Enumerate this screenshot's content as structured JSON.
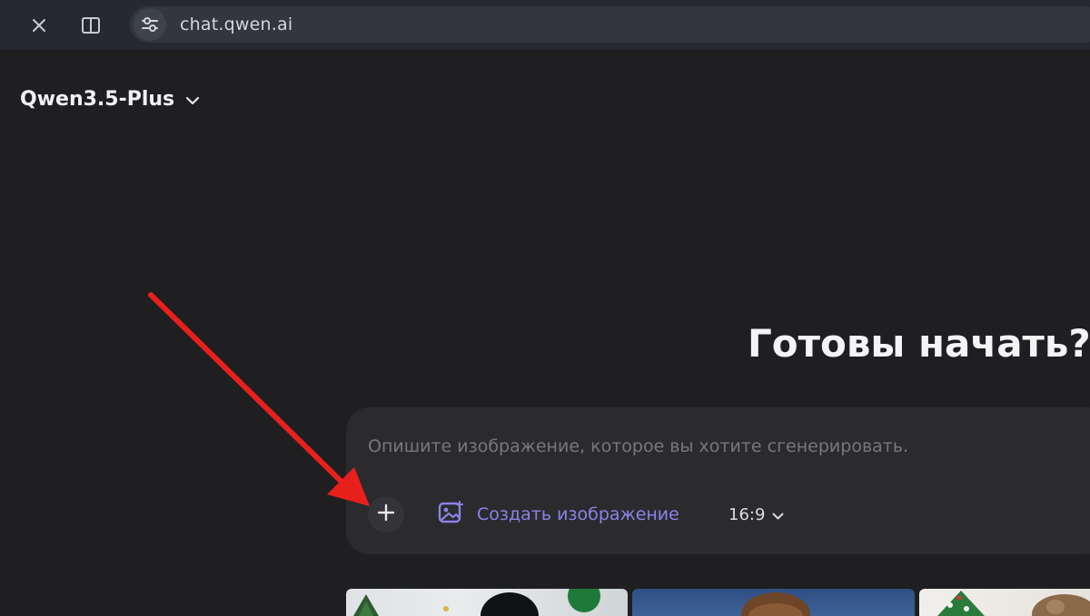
{
  "browser": {
    "url": "chat.qwen.ai",
    "icons": {
      "close": "close-icon",
      "split": "split-view-icon",
      "site_info": "site-settings-icon"
    }
  },
  "header": {
    "model_name": "Qwen3.5-Plus",
    "model_icon": "chevron-down-icon"
  },
  "hero": {
    "title": "Готовы начать?"
  },
  "composer": {
    "placeholder": "Опишите изображение, которое вы хотите сгенерировать.",
    "value": "",
    "add_icon": "plus-icon",
    "mode_label": "Создать изображение",
    "mode_icon": "image-generate-icon",
    "aspect_ratio": "16:9",
    "ratio_icon": "chevron-down-icon"
  },
  "gallery": {
    "thumbnails": [
      "thumbnail-1",
      "thumbnail-2",
      "thumbnail-3"
    ]
  },
  "colors": {
    "background": "#1f1f21",
    "browser_bar": "#26292f",
    "composer": "#2b2b2e",
    "accent": "#8b82e8",
    "annotation_arrow": "#e8201c"
  }
}
